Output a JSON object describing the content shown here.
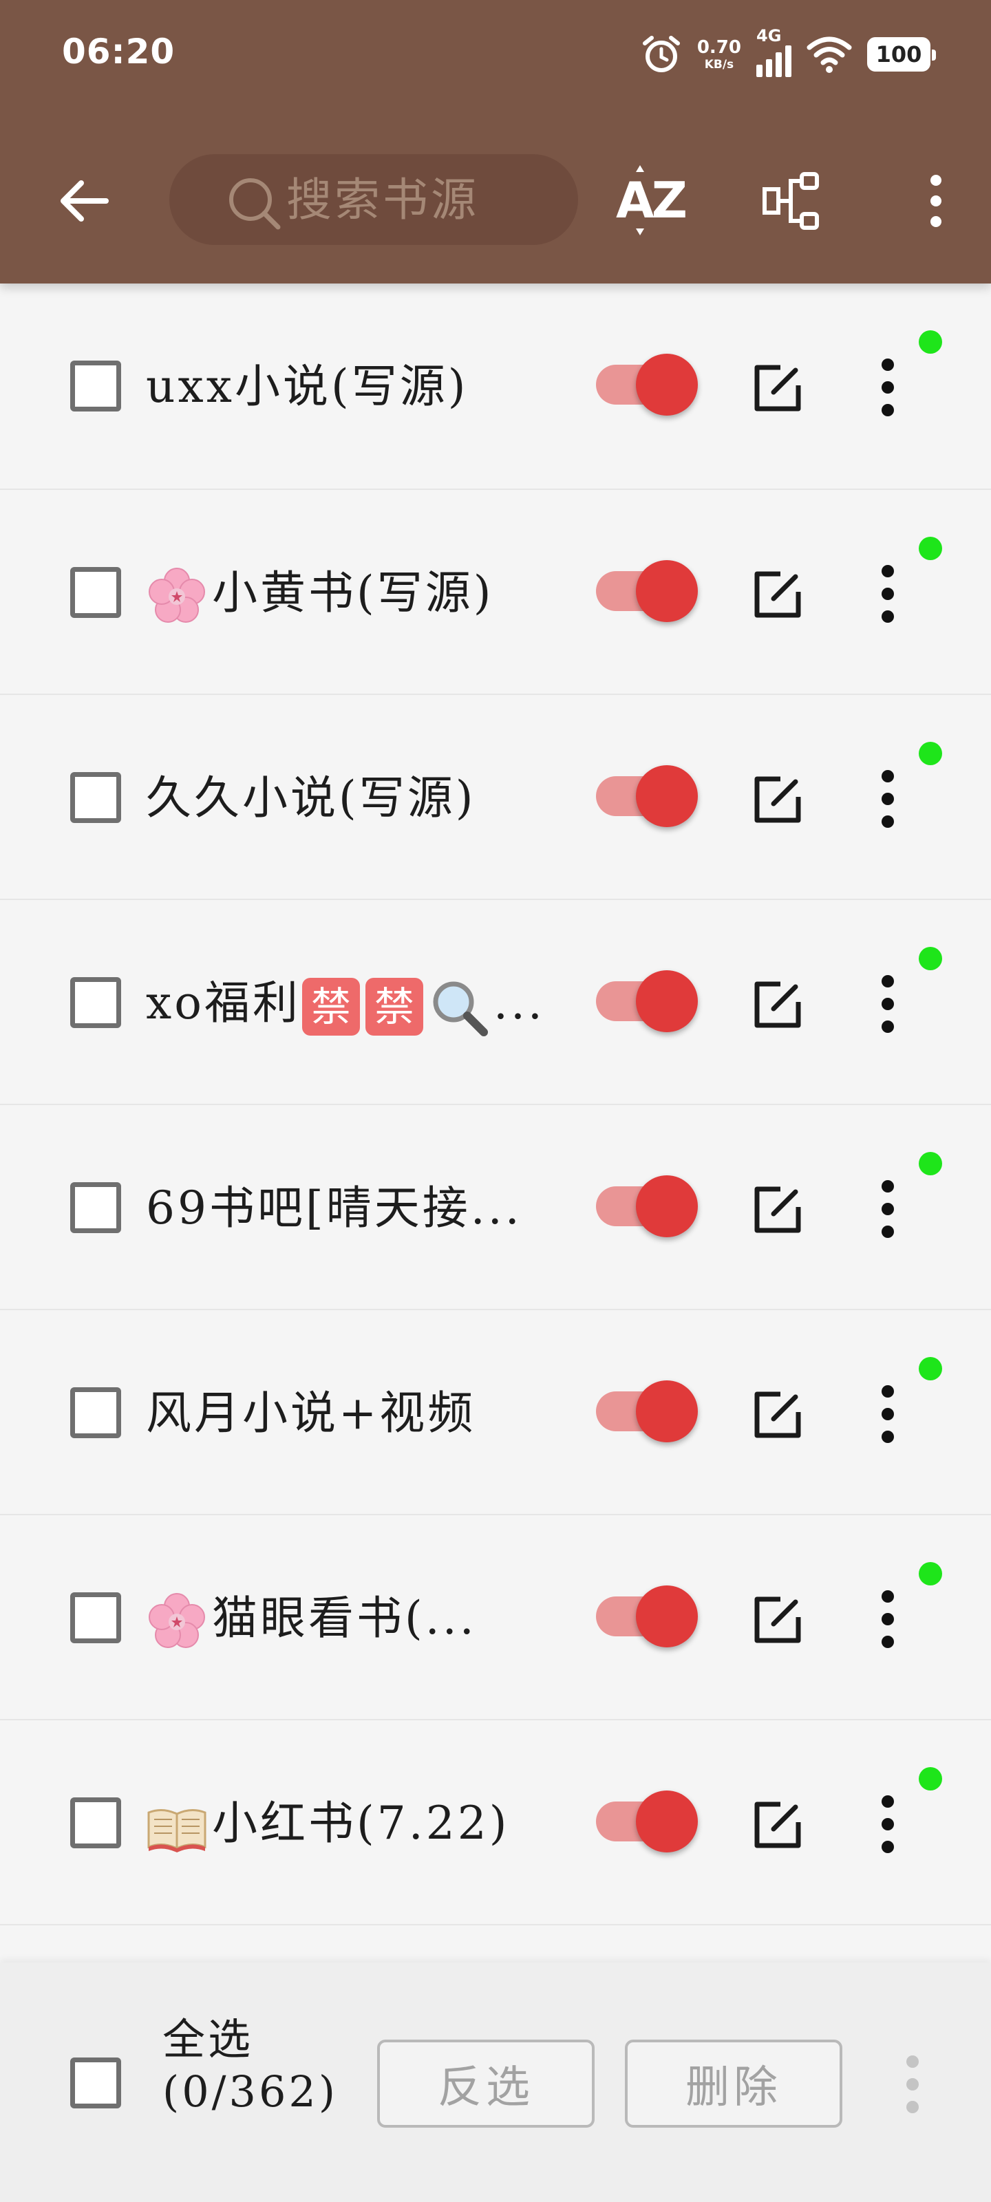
{
  "status_bar": {
    "time": "06:20",
    "net_speed_value": "0.70",
    "net_speed_unit": "KB/s",
    "signal_label": "4G",
    "battery": "100"
  },
  "toolbar": {
    "search_placeholder": "搜索书源",
    "sort_label": "AZ"
  },
  "sources": [
    {
      "name": "uxx小说(写源)",
      "enabled": true
    },
    {
      "name": "小黄书(写源)",
      "prefix_emoji": "cherry-blossom",
      "enabled": true
    },
    {
      "name": "久久小说(写源)",
      "enabled": true
    },
    {
      "name": "xo福利",
      "badge1": "禁",
      "badge2": "禁",
      "suffix": "...",
      "enabled": true
    },
    {
      "name": "69书吧[晴天接...",
      "enabled": true
    },
    {
      "name": "风月小说+视频",
      "enabled": true
    },
    {
      "name": "猫眼看书(...",
      "prefix_emoji": "cherry-blossom",
      "enabled": true
    },
    {
      "name": "小红书(7.22)",
      "prefix_emoji": "open-book",
      "enabled": true
    }
  ],
  "bottom_bar": {
    "select_all_label": "全选",
    "select_count": "(0/362)",
    "invert_label": "反选",
    "delete_label": "删除"
  },
  "colors": {
    "toolbar_bg": "#7a5646",
    "switch_on": "#e03a3a",
    "status_dot": "#1ee51a"
  }
}
